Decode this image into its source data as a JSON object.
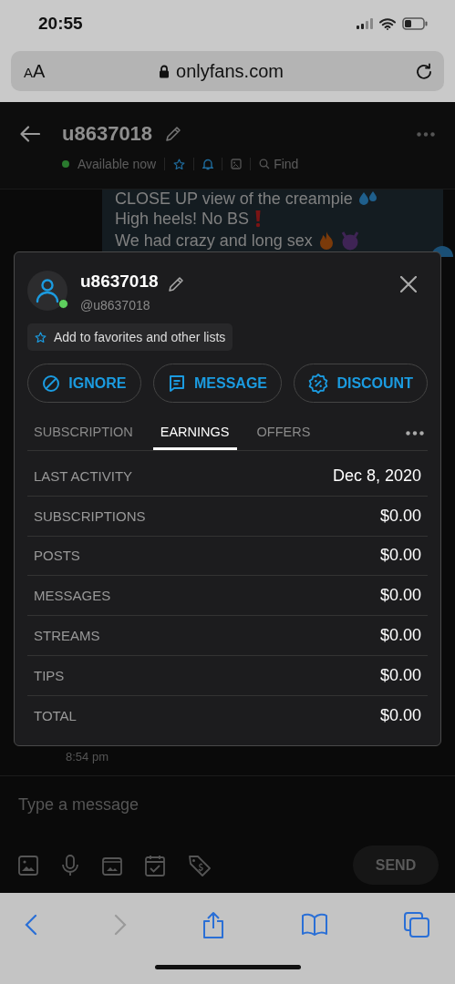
{
  "status_bar": {
    "time": "20:55"
  },
  "browser": {
    "text_size": "AA",
    "url": "onlyfans.com"
  },
  "chat_header": {
    "title": "u8637018",
    "status": "Available now",
    "online": true,
    "find": "Find"
  },
  "message": {
    "lines": [
      "CLOSE UP view of the creampie",
      "High heels! No BS",
      "We had crazy and long sex"
    ]
  },
  "message_time": "8:54 pm",
  "modal": {
    "name": "u8637018",
    "handle": "@u8637018",
    "online": true,
    "favorites": "Add to favorites and other lists",
    "actions": [
      {
        "kind": "ignore",
        "label": "IGNORE"
      },
      {
        "kind": "message",
        "label": "MESSAGE"
      },
      {
        "kind": "discount",
        "label": "DISCOUNT"
      }
    ],
    "tabs": [
      {
        "label": "SUBSCRIPTION",
        "selected": false
      },
      {
        "label": "EARNINGS",
        "selected": true
      },
      {
        "label": "OFFERS",
        "selected": false
      }
    ],
    "rows": [
      {
        "label": "LAST ACTIVITY",
        "value": "Dec 8, 2020"
      },
      {
        "label": "SUBSCRIPTIONS",
        "value": "$0.00"
      },
      {
        "label": "POSTS",
        "value": "$0.00"
      },
      {
        "label": "MESSAGES",
        "value": "$0.00"
      },
      {
        "label": "STREAMS",
        "value": "$0.00"
      },
      {
        "label": "TIPS",
        "value": "$0.00"
      },
      {
        "label": "TOTAL",
        "value": "$0.00"
      }
    ]
  },
  "composer": {
    "placeholder": "Type a message",
    "tools": [
      {
        "kind": "image"
      },
      {
        "kind": "mic"
      },
      {
        "kind": "vault"
      },
      {
        "kind": "calendar"
      },
      {
        "kind": "price"
      }
    ],
    "send": {
      "label": "SEND",
      "disabled": true
    }
  },
  "safari_toolbar": {
    "back_disabled": false,
    "forward_disabled": true
  }
}
